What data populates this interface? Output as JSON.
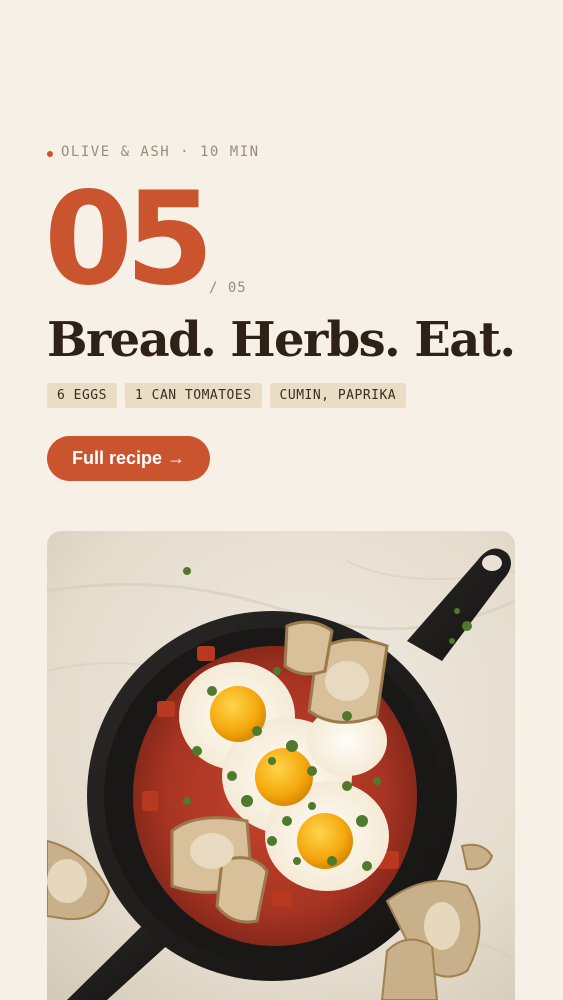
{
  "hero": {
    "kicker": "OLIVE & ASH · 10 MIN",
    "step_number": "05",
    "step_total": "/ 05",
    "headline": "Bread. Herbs. Eat.",
    "tags": [
      "6 EGGS",
      "1 CAN TOMATOES",
      "CUMIN, PAPRIKA"
    ],
    "cta_label": "Full recipe →"
  },
  "image": {
    "alt": "Shakshuka in a cast iron skillet with eggs, herbs and torn bread"
  },
  "colors": {
    "background": "#f7f0e6",
    "accent": "#c9542e",
    "text_dark": "#2e2118",
    "text_muted": "#9a8b7d",
    "tag_bg": "#ebdcc6"
  }
}
